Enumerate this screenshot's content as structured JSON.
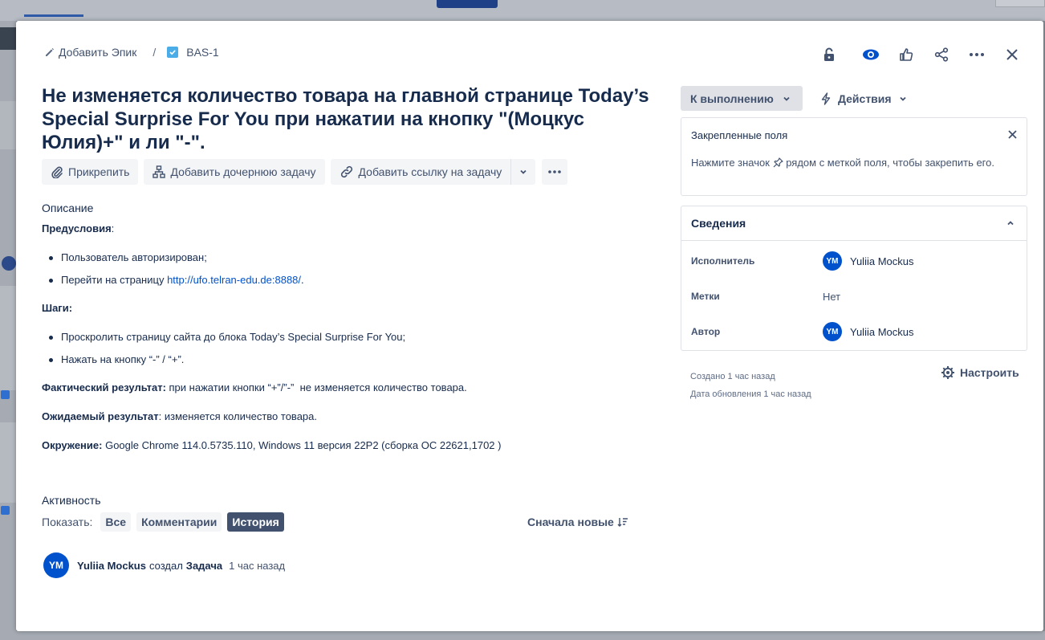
{
  "breadcrumb": {
    "add_epic": "Добавить Эпик",
    "separator": "/",
    "issue_key": "BAS-1"
  },
  "issue": {
    "title": "Не изменяется количество товара на главной странице Today’s Special Surprise For You при нажатии на кнопку \"(Моцкус Юлия)+\" и ли \"-\"."
  },
  "toolbar": {
    "attach": "Прикрепить",
    "add_child": "Добавить дочернюю задачу",
    "add_link": "Добавить ссылку на задачу",
    "more": "•••"
  },
  "description": {
    "label": "Описание",
    "preconditions_label": "Предусловия",
    "preconditions_suffix": ":",
    "preconditions": [
      {
        "text": "Пользователь авторизирован;",
        "link": "",
        "after": ""
      },
      {
        "text": "Перейти на страницу ",
        "link": "http://ufo.telran-edu.de:8888/",
        "after": "."
      }
    ],
    "steps_label": "Шаги:",
    "steps": [
      "Проскролить страницу сайта до блока Today’s Special Surprise For You;",
      "Нажать на кнопку “-” / “+”."
    ],
    "actual_label": "Фактический результат:",
    "actual_text": " при нажатии кнопки “+”/”-”  не изменяется количество товара.",
    "expected_label": "Ожидаемый результат",
    "expected_text": ": изменяется количество товара.",
    "env_label": "Окружение:",
    "env_text": " Google Chrome 114.0.5735.110, Windows 11 версия 22Р2 (сборка ОС 22621,1702 )"
  },
  "activity": {
    "label": "Активность",
    "show_label": "Показать:",
    "filters": [
      "Все",
      "Комментарии",
      "История"
    ],
    "active_filter": "История",
    "sort_label": "Сначала новые",
    "entry": {
      "avatar": "YM",
      "user": "Yuliia Mockus",
      "action": "создал",
      "object": "Задача",
      "time": "1 час назад"
    }
  },
  "sidebar": {
    "status": "К выполнению",
    "actions": "Действия",
    "pinned": {
      "title": "Закрепленные поля",
      "hint_before": "Нажмите значок",
      "hint_after": "рядом с меткой поля, чтобы закрепить его."
    },
    "details": {
      "title": "Сведения",
      "rows": [
        {
          "label": "Исполнитель",
          "avatar": "YM",
          "value": "Yuliia Mockus"
        },
        {
          "label": "Метки",
          "avatar": "",
          "value": "Нет"
        },
        {
          "label": "Автор",
          "avatar": "YM",
          "value": "Yuliia Mockus"
        }
      ]
    },
    "created": "Создано 1 час назад",
    "updated": "Дата обновления 1 час назад",
    "configure": "Настроить"
  },
  "colors": {
    "accent": "#0052cc",
    "text": "#172b4d",
    "subtle": "#42526e",
    "story_icon": "#4bade8"
  },
  "icons": {
    "top_actions": [
      "lock-icon",
      "watch-eye-icon",
      "like-thumb-icon",
      "share-icon",
      "more-icon",
      "close-icon"
    ]
  }
}
